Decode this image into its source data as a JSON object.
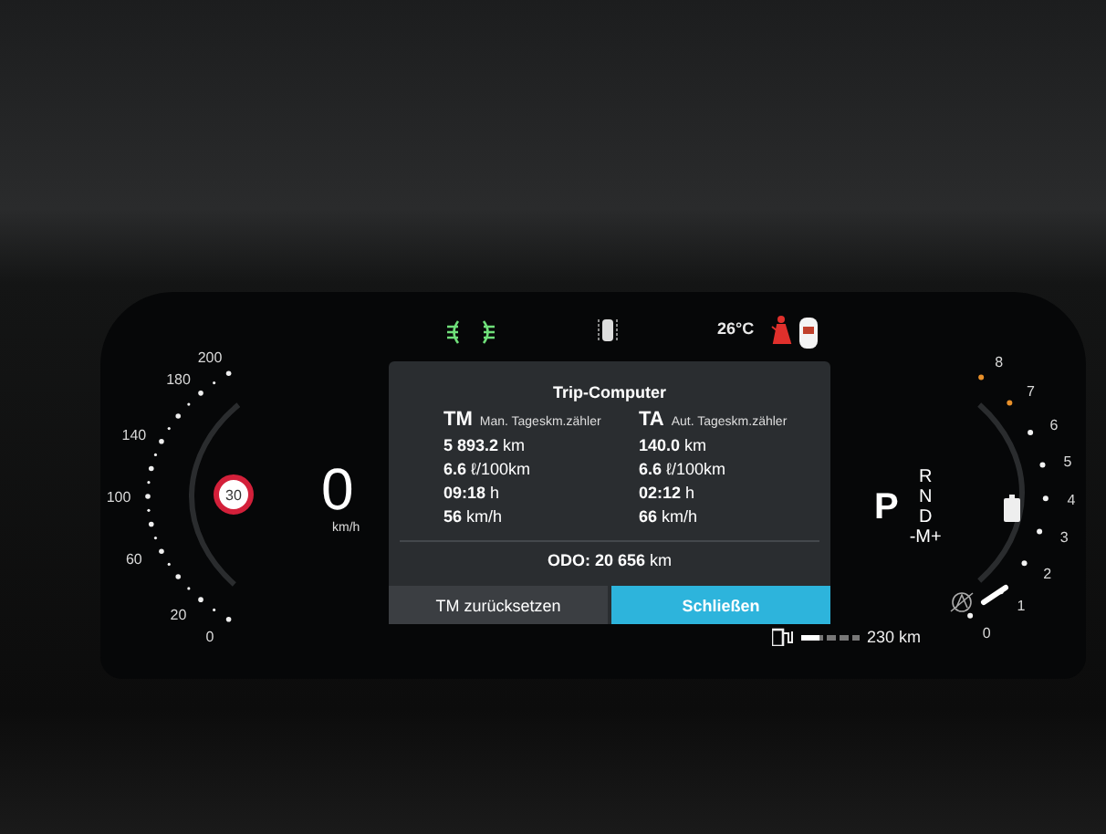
{
  "top_bar": {
    "temperature": "26°C"
  },
  "speedometer": {
    "ticks": [
      "200",
      "180",
      "140",
      "100",
      "60",
      "20",
      "0"
    ],
    "speed_limit": "30",
    "speed": "0",
    "unit": "km/h"
  },
  "tachometer": {
    "ticks": [
      {
        "label": "8",
        "color": "#e8902a"
      },
      {
        "label": "7",
        "color": "#e8902a"
      },
      {
        "label": "6",
        "color": "#f2f2f2"
      },
      {
        "label": "5",
        "color": "#f2f2f2"
      },
      {
        "label": "4",
        "color": "#f2f2f2"
      },
      {
        "label": "3",
        "color": "#f2f2f2"
      },
      {
        "label": "2",
        "color": "#f2f2f2"
      },
      {
        "label": "1",
        "color": "#f2f2f2"
      },
      {
        "label": "0",
        "color": "#f2f2f2"
      }
    ]
  },
  "gear": {
    "current": "P",
    "options": [
      "R",
      "N",
      "D"
    ],
    "manual": "-M+"
  },
  "trip_computer": {
    "title": "Trip-Computer",
    "columns": [
      {
        "code": "TM",
        "name": "Man. Tageskm.zähler",
        "rows": [
          {
            "value": "5 893.2",
            "unit": "km"
          },
          {
            "value": "6.6",
            "unit": "ℓ/100km"
          },
          {
            "value": "09:18",
            "unit": "h"
          },
          {
            "value": "56",
            "unit": "km/h"
          }
        ]
      },
      {
        "code": "TA",
        "name": "Aut. Tageskm.zähler",
        "rows": [
          {
            "value": "140.0",
            "unit": "km"
          },
          {
            "value": "6.6",
            "unit": "ℓ/100km"
          },
          {
            "value": "02:12",
            "unit": "h"
          },
          {
            "value": "66",
            "unit": "km/h"
          }
        ]
      }
    ],
    "odometer": {
      "label": "ODO:",
      "value": "20 656",
      "unit": "km"
    },
    "buttons": [
      {
        "label": "TM zurücksetzen",
        "selected": false
      },
      {
        "label": "Schließen",
        "selected": true
      }
    ]
  },
  "range": {
    "level": 0.3,
    "value": "230",
    "unit": "km"
  }
}
